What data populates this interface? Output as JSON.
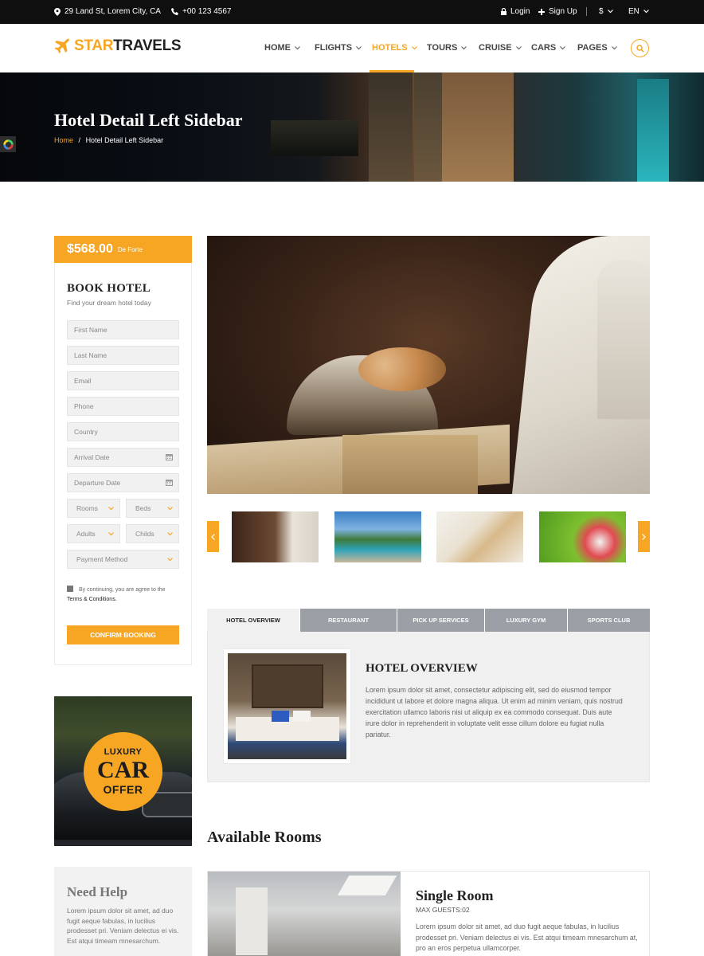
{
  "topbar": {
    "address": "29 Land St, Lorem City, CA",
    "phone": "+00 123 4567",
    "login": "Login",
    "signup": "Sign Up",
    "currency": "$",
    "language": "EN"
  },
  "header": {
    "logo_part1": "STAR",
    "logo_part2": "TRAVELS",
    "nav": [
      "HOME",
      "FLIGHTS",
      "HOTELS",
      "TOURS",
      "CRUISE",
      "CARS",
      "PAGES"
    ],
    "active_nav": "HOTELS"
  },
  "hero": {
    "title": "Hotel Detail Left Sidebar",
    "breadcrumb_home": "Home",
    "breadcrumb_sep": "/",
    "breadcrumb_current": "Hotel Detail Left Sidebar"
  },
  "booking": {
    "price": "$568.00",
    "price_label": "De Forte",
    "title": "BOOK HOTEL",
    "subtitle": "Find your dream hotel today",
    "fields": {
      "first_name": "First Name",
      "last_name": "Last Name",
      "email": "Email",
      "phone": "Phone",
      "country": "Country",
      "arrival": "Arrival Date",
      "departure": "Departure Date",
      "rooms": "Rooms",
      "beds": "Beds",
      "adults": "Adults",
      "childs": "Childs",
      "payment": "Payment Method"
    },
    "terms_text": "By continuing, you are agree to the",
    "terms_link": "Terms & Conditions.",
    "confirm": "CONFIRM BOOKING"
  },
  "car_offer": {
    "line1": "LUXURY",
    "line2": "CAR",
    "line3": "OFFER"
  },
  "help": {
    "title": "Need Help",
    "text": "Lorem ipsum dolor sit amet, ad duo fugit aeque fabulas, in lucilius prodesset pri. Veniam delectus ei vis. Est atqui timeam mnesarchum."
  },
  "tabs": [
    "HOTEL OVERVIEW",
    "RESTAURANT",
    "PICK UP SERVICES",
    "LUXURY GYM",
    "SPORTS CLUB"
  ],
  "overview": {
    "title": "HOTEL OVERVIEW",
    "text": "Lorem ipsum dolor sit amet, consectetur adipiscing elit, sed do eiusmod tempor incididunt ut labore et dolore magna aliqua. Ut enim ad minim veniam, quis nostrud exercitation ullamco laboris nisi ut aliquip ex ea commodo consequat. Duis aute irure dolor in reprehenderit in voluptate velit esse cillum dolore eu fugiat nulla pariatur."
  },
  "rooms": {
    "heading": "Available Rooms",
    "items": [
      {
        "name": "Single Room",
        "guests": "MAX GUESTS:02",
        "text": "Lorem ipsum dolor sit amet, ad duo fugit aeque fabulas, in lucilius prodesset pri. Veniam delectus ei vis. Est atqui timeam mnesarchum at, pro an eros perpetua ullamcorper."
      }
    ]
  },
  "colors": {
    "accent": "#f6a623",
    "topbar": "#0f0f0f",
    "tab_inactive": "#9aa0a6"
  },
  "icons": [
    "map-marker-icon",
    "phone-icon",
    "lock-icon",
    "plus-icon",
    "search-icon",
    "calendar-icon",
    "chevron-down-icon",
    "chevron-left-icon",
    "chevron-right-icon",
    "plane-icon"
  ]
}
